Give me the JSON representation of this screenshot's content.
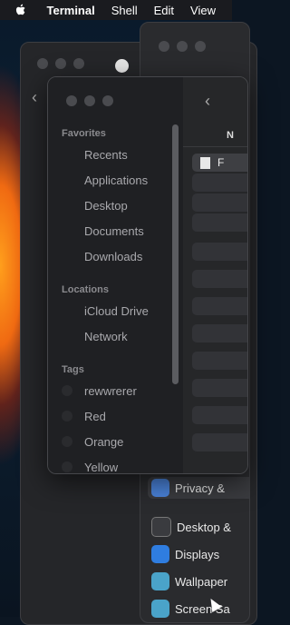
{
  "menubar": {
    "apple_icon": "apple-logo-icon",
    "items": [
      "Terminal",
      "Shell",
      "Edit",
      "View"
    ]
  },
  "finder": {
    "favorites_label": "Favorites",
    "favorites": [
      "Recents",
      "Applications",
      "Desktop",
      "Documents",
      "Downloads"
    ],
    "locations_label": "Locations",
    "locations": [
      "iCloud Drive",
      "Network"
    ],
    "tags_label": "Tags",
    "tags": [
      {
        "label": "rewwrerer",
        "color": "#2a2b2e"
      },
      {
        "label": "Red",
        "color": "#2a2b2e"
      },
      {
        "label": "Orange",
        "color": "#2a2b2e"
      },
      {
        "label": "Yellow",
        "color": "#2a2b2e"
      }
    ],
    "column_header": "N",
    "first_file": "F"
  },
  "settings": {
    "items": [
      {
        "label": "Privacy &",
        "icon": "hand-icon",
        "color": "#4a82d8"
      },
      {
        "label": "Desktop &",
        "icon": "dock-icon",
        "color": "#3a3b3f"
      },
      {
        "label": "Displays",
        "icon": "sun-icon",
        "color": "#2f7de0"
      },
      {
        "label": "Wallpaper",
        "icon": "wallpaper-icon",
        "color": "#4aa3c9"
      },
      {
        "label": "Screen Sa",
        "icon": "screensaver-icon",
        "color": "#4aa3c9"
      }
    ]
  }
}
